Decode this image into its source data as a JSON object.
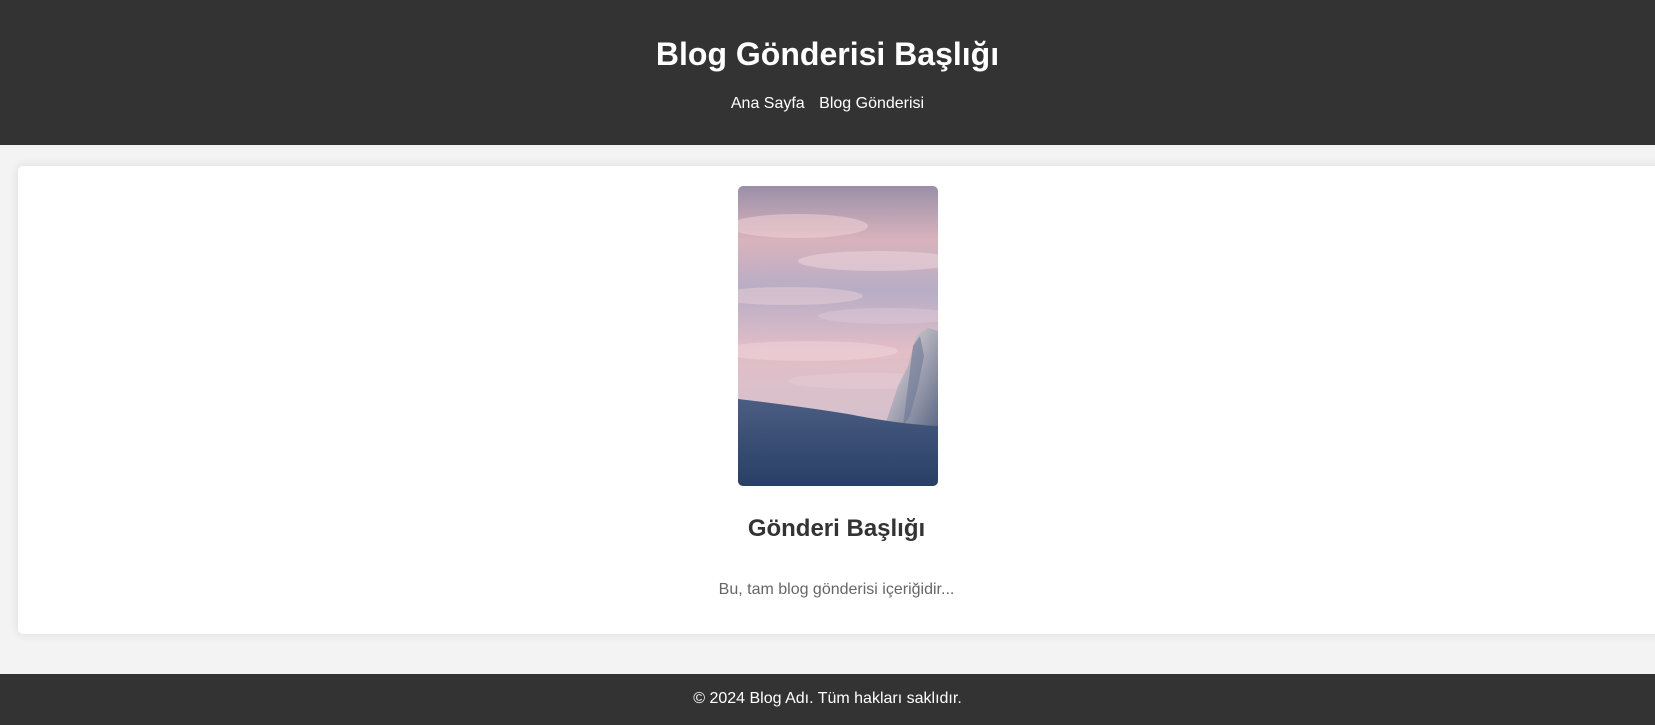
{
  "header": {
    "title": "Blog Gönderisi Başlığı",
    "nav": [
      {
        "label": "Ana Sayfa"
      },
      {
        "label": "Blog Gönderisi"
      }
    ]
  },
  "post": {
    "image": {
      "icon": "mountain-sunset-photo"
    },
    "title": "Gönderi Başlığı",
    "content": "Bu, tam blog gönderisi içeriğidir..."
  },
  "footer": {
    "text": "© 2024 Blog Adı. Tüm hakları saklıdır."
  },
  "colors": {
    "header_bg": "#333333",
    "page_bg": "#f3f3f3",
    "card_bg": "#ffffff",
    "footer_bg": "#333333"
  }
}
